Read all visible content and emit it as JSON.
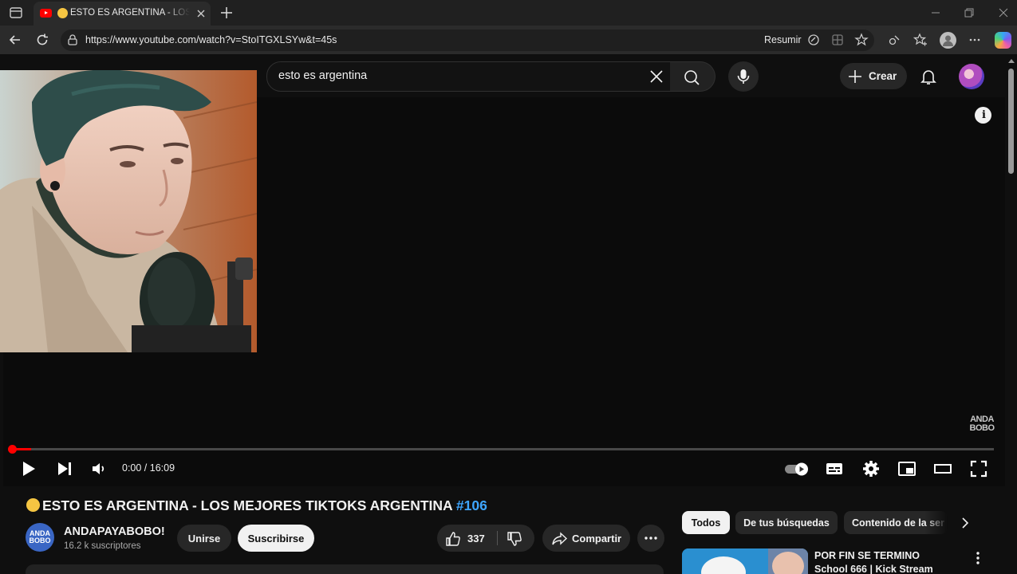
{
  "browser": {
    "tab_title": "ESTO ES ARGENTINA - LOS MEJORES TIKTOKS",
    "url": "https://www.youtube.com/watch?v=StoITGXLSYw&t=45s",
    "resumir_label": "Resumir"
  },
  "masthead": {
    "search_query": "esto es argentina",
    "create_label": "Crear"
  },
  "player": {
    "time_display": "0:00 / 16:09",
    "progress": 0.02,
    "watermark_line1": "ANDA",
    "watermark_line2": "BOBO"
  },
  "video": {
    "title": "ESTO ES ARGENTINA - LOS MEJORES TIKTOKS ARGENTINA ",
    "hashtag": "#106",
    "channel_name": "ANDAPAYABOBO!",
    "channel_avatar_line1": "ANDA",
    "channel_avatar_line2": "BOBO",
    "subscribers": "16.2 k suscriptores",
    "join_label": "Unirse",
    "subscribe_label": "Suscribirse",
    "like_count": "337",
    "share_label": "Compartir"
  },
  "chips": [
    "Todos",
    "De tus búsquedas",
    "Contenido de la ser"
  ],
  "recommendation": {
    "title": "POR FIN SE TERMINO School 666 | Kick Stream"
  },
  "colors": {
    "accent_red": "#ff0000",
    "hashtag_blue": "#3ea6ff",
    "background": "#0f0f0f"
  }
}
